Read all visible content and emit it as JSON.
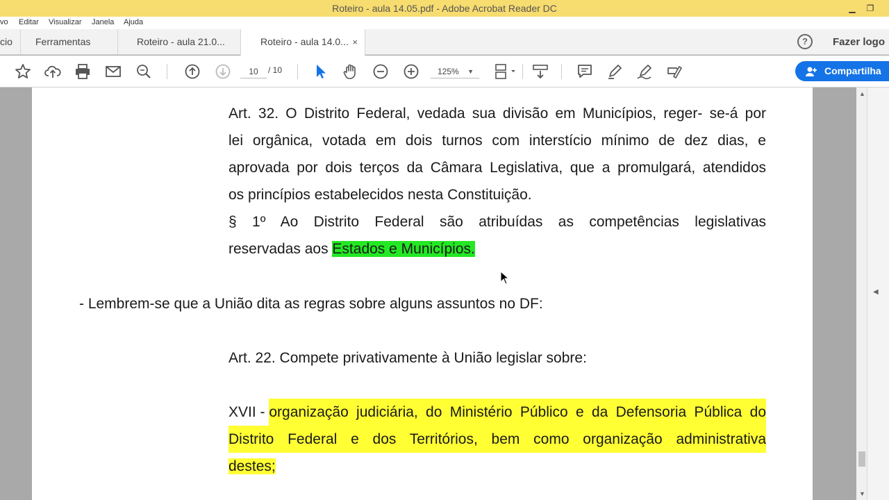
{
  "window": {
    "title": "Roteiro - aula 14.05.pdf - Adobe Acrobat Reader DC"
  },
  "menu": {
    "items": [
      "vo",
      "Editar",
      "Visualizar",
      "Janela",
      "Ajuda"
    ]
  },
  "tabs": {
    "home_partial": "cio",
    "tools": "Ferramentas",
    "doc1": "Roteiro - aula 21.0...",
    "doc2": "Roteiro - aula 14.0...",
    "close_glyph": "×"
  },
  "header": {
    "help_glyph": "?",
    "login_label": "Fazer logo"
  },
  "toolbar": {
    "page_current": "10",
    "page_total": "/ 10",
    "zoom": "125%",
    "share_label": "Compartilha"
  },
  "document": {
    "art32": {
      "line1": "Art. 32. O Distrito Federal, vedada sua divisão em Municípios, reger- se-á por",
      "line2": "lei orgânica, votada em dois turnos com interstício mínimo de dez dias, e",
      "line3": "aprovada por dois terços da Câmara Legislativa, que a promulgará, atendidos",
      "line4": "os princípios estabelecidos nesta Constituição.",
      "par1_line1": "§ 1º Ao Distrito Federal são atribuídas as competências legislativas",
      "par1_line2_prefix": "reservadas aos ",
      "par1_line2_highlight": "Estados e Municípios."
    },
    "note": "- Lembrem-se que a União dita as regras sobre alguns assuntos no DF:",
    "art22": "Art. 22. Compete privativamente à União legislar sobre:",
    "xvii": {
      "prefix": "XVII - ",
      "line1_highlight": "organização judiciária, do Ministério Público e da Defensoria Pública do",
      "line2_highlight": "Distrito Federal e dos Territórios, bem como organização administrativa",
      "line3_highlight": "destes;"
    }
  },
  "colors": {
    "titlebar": "#f7dc6f",
    "highlight_green": "#23e823",
    "highlight_yellow": "#ffff33",
    "share_button": "#1473e6"
  }
}
